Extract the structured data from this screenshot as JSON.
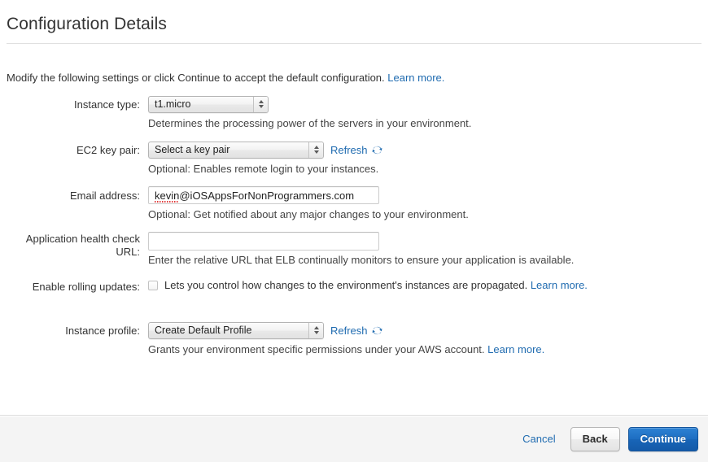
{
  "page": {
    "title": "Configuration Details",
    "intro_text": "Modify the following settings or click Continue to accept the default configuration.",
    "intro_link": "Learn more."
  },
  "form": {
    "instance_type": {
      "label": "Instance type:",
      "value": "t1.micro",
      "help": "Determines the processing power of the servers in your environment."
    },
    "ec2_key_pair": {
      "label": "EC2 key pair:",
      "value": "Select a key pair",
      "refresh_label": "Refresh",
      "refresh_icon": "refresh-icon",
      "help": "Optional: Enables remote login to your instances."
    },
    "email_address": {
      "label": "Email address:",
      "value_misspelled": "kevin",
      "value_rest": "@iOSAppsForNonProgrammers.com",
      "placeholder": "",
      "help": "Optional: Get notified about any major changes to your environment."
    },
    "health_check_url": {
      "label_line1": "Application health check",
      "label_line2": "URL:",
      "value": "",
      "placeholder": "",
      "help": "Enter the relative URL that ELB continually monitors to ensure your application is available."
    },
    "rolling_updates": {
      "label": "Enable rolling updates:",
      "checked": false,
      "description": "Lets you control how changes to the environment's instances are propagated.",
      "link": "Learn more."
    },
    "instance_profile": {
      "label": "Instance profile:",
      "value": "Create Default Profile",
      "refresh_label": "Refresh",
      "refresh_icon": "refresh-icon",
      "help": "Grants your environment specific permissions under your AWS account.",
      "help_link": "Learn more."
    }
  },
  "footer": {
    "cancel_label": "Cancel",
    "back_label": "Back",
    "continue_label": "Continue"
  },
  "colors": {
    "link_blue": "#1f6bb0",
    "primary_button": "#1d6dc1",
    "spellcheck_red": "#e03a3a",
    "text": "#333333"
  }
}
